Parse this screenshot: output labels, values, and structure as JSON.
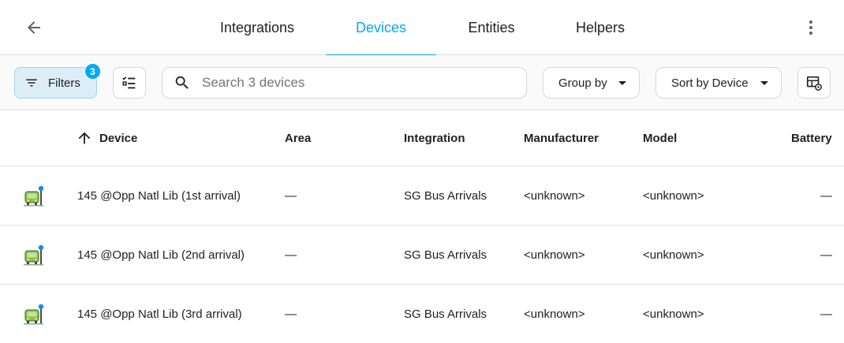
{
  "header": {
    "tabs": [
      {
        "label": "Integrations",
        "active": false
      },
      {
        "label": "Devices",
        "active": true
      },
      {
        "label": "Entities",
        "active": false
      },
      {
        "label": "Helpers",
        "active": false
      }
    ],
    "icons": {
      "back": "arrow-left-icon",
      "more": "dots-vertical-icon"
    }
  },
  "toolbar": {
    "filters_label": "Filters",
    "filters_count": "3",
    "search_placeholder": "Search 3 devices",
    "search_value": "",
    "group_by_label": "Group by",
    "sort_by_label": "Sort by Device",
    "icons": {
      "filter": "filter-lines-icon",
      "select_mode": "checklist-icon",
      "search": "magnify-icon",
      "settings": "table-cog-icon",
      "caret": "menu-down-icon"
    }
  },
  "table": {
    "columns": {
      "device": "Device",
      "area": "Area",
      "integration": "Integration",
      "manufacturer": "Manufacturer",
      "model": "Model",
      "battery": "Battery"
    },
    "sort": {
      "column": "device",
      "direction": "ascending"
    },
    "rows": [
      {
        "icon": "bus-stop-icon",
        "device": "145 @Opp Natl Lib (1st arrival)",
        "area": "—",
        "integration": "SG Bus Arrivals",
        "manufacturer": "<unknown>",
        "model": "<unknown>",
        "battery": "—"
      },
      {
        "icon": "bus-stop-icon",
        "device": "145 @Opp Natl Lib (2nd arrival)",
        "area": "—",
        "integration": "SG Bus Arrivals",
        "manufacturer": "<unknown>",
        "model": "<unknown>",
        "battery": "—"
      },
      {
        "icon": "bus-stop-icon",
        "device": "145 @Opp Natl Lib (3rd arrival)",
        "area": "—",
        "integration": "SG Bus Arrivals",
        "manufacturer": "<unknown>",
        "model": "<unknown>",
        "battery": "—"
      }
    ]
  },
  "colors": {
    "accent": "#03a9f4",
    "filter_bg": "#dcedf8",
    "text": "#212121"
  }
}
